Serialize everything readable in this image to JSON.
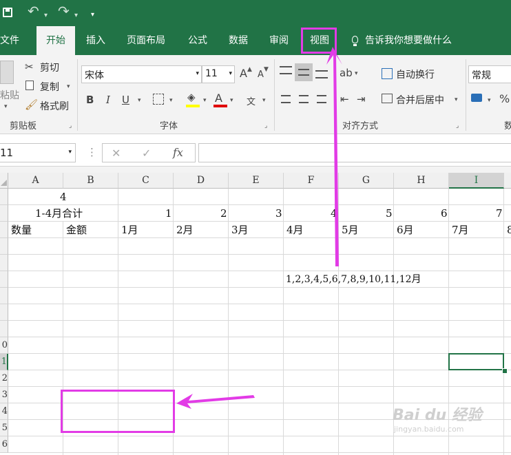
{
  "titlebar": {
    "undo": "↶",
    "redo": "↷",
    "more": "▾"
  },
  "tabs": [
    "文件",
    "开始",
    "插入",
    "页面布局",
    "公式",
    "数据",
    "审阅",
    "视图"
  ],
  "tell_me": "告诉我你想要做什么",
  "clipboard": {
    "paste": "粘贴",
    "cut": "剪切",
    "copy": "复制",
    "format_painter": "格式刷",
    "group": "剪贴板"
  },
  "font": {
    "name": "宋体",
    "size": "11",
    "grow": "A",
    "shrink": "A",
    "bold": "B",
    "italic": "I",
    "underline": "U",
    "font_color": "A",
    "phonetic": "文",
    "group": "字体"
  },
  "alignment": {
    "wrap": "自动换行",
    "merge": "合并后居中",
    "group": "对齐方式"
  },
  "number": {
    "format": "常规",
    "percent": "%",
    "group": "数"
  },
  "formula_bar": {
    "name_box": "11",
    "cancel": "✕",
    "enter": "✓",
    "fx": "fx"
  },
  "columns": [
    "A",
    "B",
    "C",
    "D",
    "E",
    "F",
    "G",
    "H",
    "I"
  ],
  "rows": [
    "",
    "",
    "",
    "",
    "",
    "",
    "",
    "",
    "",
    "0",
    "1",
    "2",
    "3",
    "4",
    "5",
    "6"
  ],
  "cells": {
    "r1_a": "4",
    "r2_a": "1-4月合计",
    "r2_c": "1",
    "r2_d": "2",
    "r2_e": "3",
    "r2_f": "4",
    "r2_g": "5",
    "r2_h": "6",
    "r2_i": "7",
    "r3_a": "数量",
    "r3_b": "金额",
    "r3_c": "1月",
    "r3_d": "2月",
    "r3_e": "3月",
    "r3_f": "4月",
    "r3_g": "5月",
    "r3_h": "6月",
    "r3_i": "7月",
    "r3_j": "8",
    "r6_f": "1,2,3,4,5,6,7,8,9,10,11,12月"
  },
  "watermark": {
    "brand": "Bai du 经验",
    "url": "jingyan.baidu.com"
  },
  "colors": {
    "excel_green": "#217346",
    "highlight": "#e23be6"
  }
}
